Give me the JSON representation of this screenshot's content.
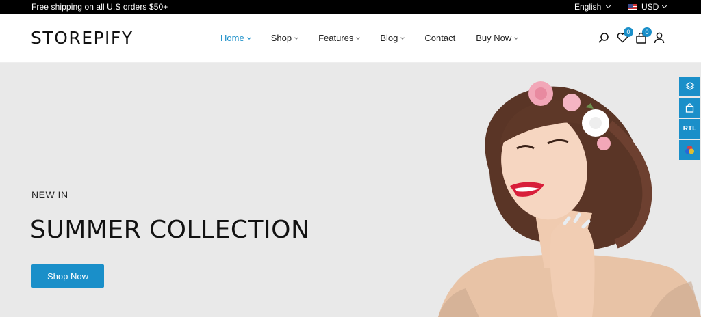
{
  "topbar": {
    "shipping_text": "Free shipping on all U.S orders $50+",
    "language": "English",
    "currency": "USD"
  },
  "header": {
    "logo": "STOREPIFY",
    "nav": [
      {
        "label": "Home",
        "active": true,
        "dropdown": true
      },
      {
        "label": "Shop",
        "active": false,
        "dropdown": true
      },
      {
        "label": "Features",
        "active": false,
        "dropdown": true
      },
      {
        "label": "Blog",
        "active": false,
        "dropdown": true
      },
      {
        "label": "Contact",
        "active": false,
        "dropdown": false
      },
      {
        "label": "Buy Now",
        "active": false,
        "dropdown": true
      }
    ],
    "wishlist_count": "0",
    "cart_count": "0"
  },
  "hero": {
    "kicker": "NEW IN",
    "headline": "SUMMER COLLECTION",
    "cta_label": "Shop Now"
  },
  "side_tools": {
    "rtl_label": "RTL"
  },
  "colors": {
    "accent": "#1a8fc9",
    "hero_bg": "#e9e9e9",
    "topbar_bg": "#000000"
  }
}
